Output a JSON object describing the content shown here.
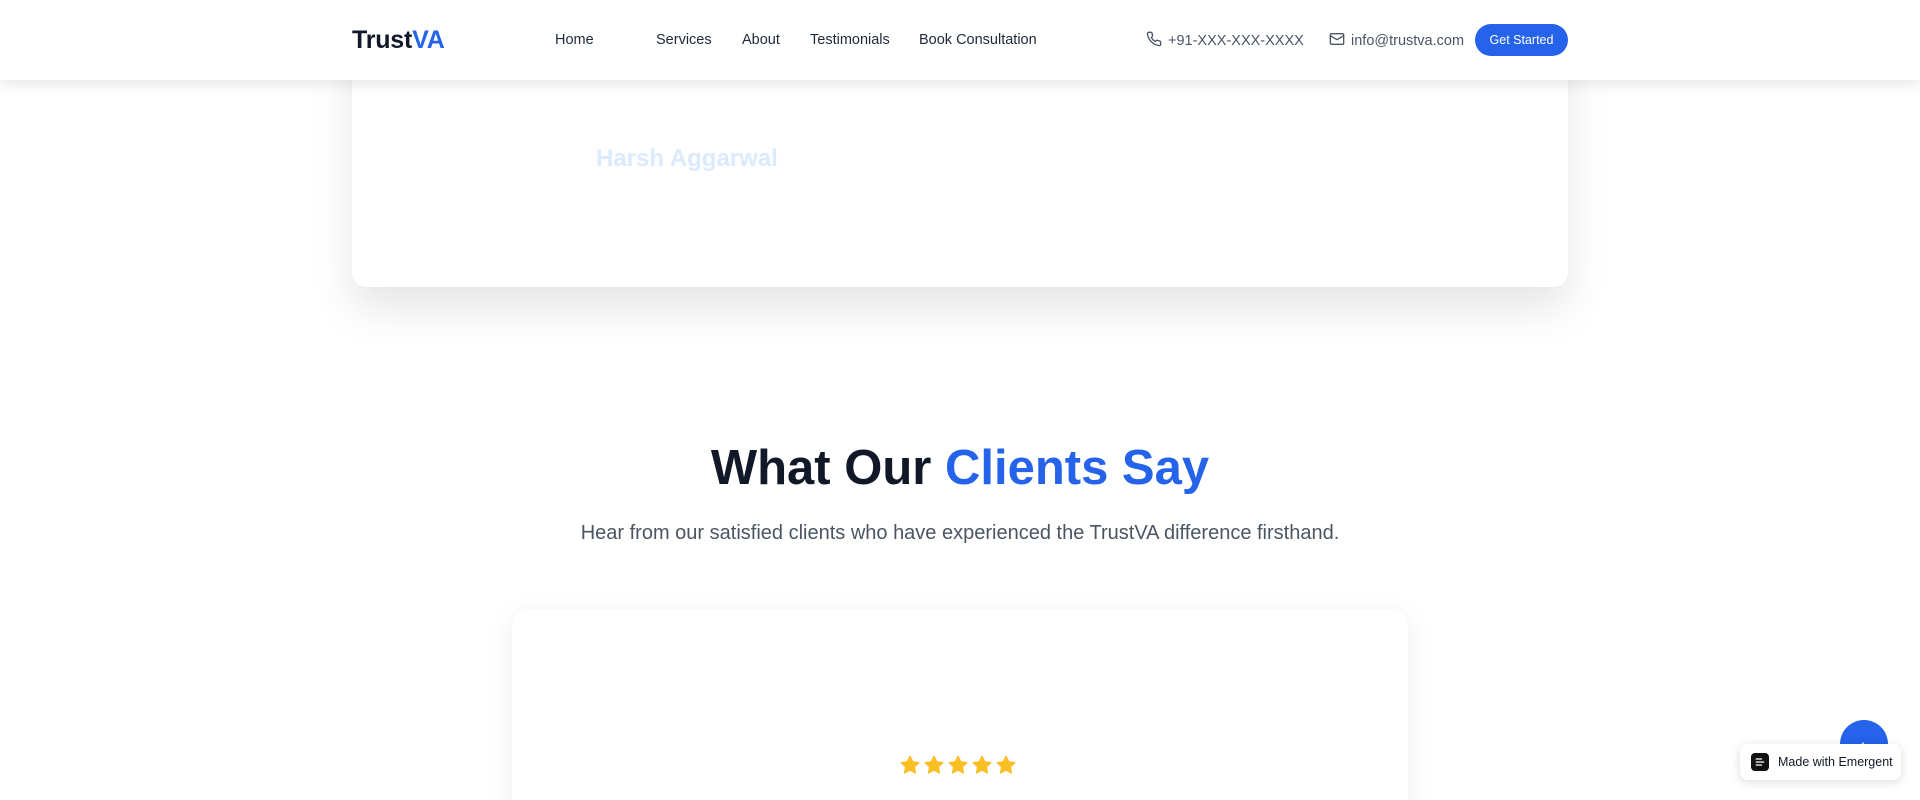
{
  "navbar": {
    "logo": {
      "main": "Trust",
      "accent": "VA"
    },
    "links": [
      {
        "label": "Home"
      },
      {
        "label": "Services"
      },
      {
        "label": "About"
      },
      {
        "label": "Testimonials"
      },
      {
        "label": "Book Consultation"
      }
    ],
    "phone": {
      "icon": "phone-icon",
      "text": "+91-XXX-XXX-XXXX"
    },
    "email": {
      "icon": "mail-icon",
      "text": "info@trustva.com"
    },
    "cta_label": "Get Started"
  },
  "founder_card": {
    "name": "Harsh Aggarwal"
  },
  "testimonials": {
    "title_main": "What Our ",
    "title_accent": "Clients Say",
    "subtitle": "Hear from our satisfied clients who have experienced the TrustVA difference firsthand.",
    "rating": 5,
    "star_icon": "star-icon"
  },
  "fab": {
    "icon": "arrow-left-icon"
  },
  "badge": {
    "icon": "emergent-logo-icon",
    "label": "Made with Emergent"
  },
  "colors": {
    "accent": "#2563eb",
    "heading": "#111827",
    "muted": "#4b5563",
    "star": "#fbbf24",
    "faded_name": "#dbeafe"
  }
}
